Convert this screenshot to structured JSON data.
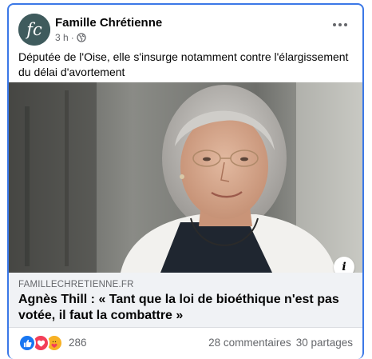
{
  "post": {
    "page_name": "Famille Chrétienne",
    "timestamp": "3 h",
    "separator": "·",
    "avatar_letters": "fc",
    "text": "Députée de l'Oise, elle s'insurge notamment contre l'élargissement du délai d'avortement"
  },
  "link": {
    "domain": "FAMILLECHRETIENNE.FR",
    "title": "Agnès Thill : « Tant que la loi de bioéthique n'est pas votée, il faut la combattre »",
    "info_label": "i"
  },
  "stats": {
    "reaction_count": "286",
    "comments": "28 commentaires",
    "shares": "30 partages",
    "reaction_icons": [
      "like-icon",
      "love-icon",
      "care-icon"
    ]
  },
  "colors": {
    "avatar_bg": "#3f5b5d",
    "card_border": "#3b78e7",
    "like_blue": "#1877f2",
    "love_red": "#f33e58",
    "care_yellow": "#f7b125",
    "meta_gray": "#65676b"
  }
}
